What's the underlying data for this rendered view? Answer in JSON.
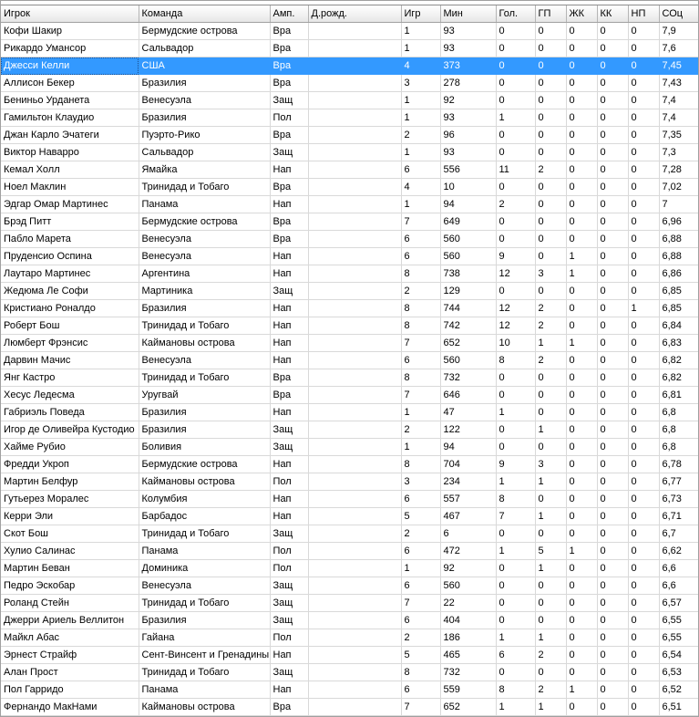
{
  "table": {
    "columns": [
      "Игрок",
      "Команда",
      "Амп.",
      "Д.рожд.",
      "Игр",
      "Мин",
      "Гол.",
      "ГП",
      "ЖК",
      "КК",
      "НП",
      "СОц"
    ],
    "selected_index": 2,
    "rows": [
      [
        "Кофи Шакир",
        "Бермудские острова",
        "Вра",
        "",
        "1",
        "93",
        "0",
        "0",
        "0",
        "0",
        "0",
        "7,9"
      ],
      [
        "Рикардо Умансор",
        "Сальвадор",
        "Вра",
        "",
        "1",
        "93",
        "0",
        "0",
        "0",
        "0",
        "0",
        "7,6"
      ],
      [
        "Джесси Келли",
        "США",
        "Вра",
        "",
        "4",
        "373",
        "0",
        "0",
        "0",
        "0",
        "0",
        "7,45"
      ],
      [
        "Аллисон Бекер",
        "Бразилия",
        "Вра",
        "",
        "3",
        "278",
        "0",
        "0",
        "0",
        "0",
        "0",
        "7,43"
      ],
      [
        "Бениньо Урданета",
        "Венесуэла",
        "Защ",
        "",
        "1",
        "92",
        "0",
        "0",
        "0",
        "0",
        "0",
        "7,4"
      ],
      [
        "Гамильтон Клаудио",
        "Бразилия",
        "Пол",
        "",
        "1",
        "93",
        "1",
        "0",
        "0",
        "0",
        "0",
        "7,4"
      ],
      [
        "Джан Карло Эчатеги",
        "Пуэрто-Рико",
        "Вра",
        "",
        "2",
        "96",
        "0",
        "0",
        "0",
        "0",
        "0",
        "7,35"
      ],
      [
        "Виктор Наварро",
        "Сальвадор",
        "Защ",
        "",
        "1",
        "93",
        "0",
        "0",
        "0",
        "0",
        "0",
        "7,3"
      ],
      [
        "Кемал Холл",
        "Ямайка",
        "Нап",
        "",
        "6",
        "556",
        "11",
        "2",
        "0",
        "0",
        "0",
        "7,28"
      ],
      [
        "Ноел Маклин",
        "Тринидад и Тобаго",
        "Вра",
        "",
        "4",
        "10",
        "0",
        "0",
        "0",
        "0",
        "0",
        "7,02"
      ],
      [
        "Эдгар Омар Мартинес",
        "Панама",
        "Нап",
        "",
        "1",
        "94",
        "2",
        "0",
        "0",
        "0",
        "0",
        "7"
      ],
      [
        "Брэд Питт",
        "Бермудские острова",
        "Вра",
        "",
        "7",
        "649",
        "0",
        "0",
        "0",
        "0",
        "0",
        "6,96"
      ],
      [
        "Пабло Марета",
        "Венесуэла",
        "Вра",
        "",
        "6",
        "560",
        "0",
        "0",
        "0",
        "0",
        "0",
        "6,88"
      ],
      [
        "Пруденсио Оспина",
        "Венесуэла",
        "Нап",
        "",
        "6",
        "560",
        "9",
        "0",
        "1",
        "0",
        "0",
        "6,88"
      ],
      [
        "Лаутаро Мартинес",
        "Аргентина",
        "Нап",
        "",
        "8",
        "738",
        "12",
        "3",
        "1",
        "0",
        "0",
        "6,86"
      ],
      [
        "Жедюма Ле Софи",
        "Мартиника",
        "Защ",
        "",
        "2",
        "129",
        "0",
        "0",
        "0",
        "0",
        "0",
        "6,85"
      ],
      [
        "Кристиано Роналдо",
        "Бразилия",
        "Нап",
        "",
        "8",
        "744",
        "12",
        "2",
        "0",
        "0",
        "1",
        "6,85"
      ],
      [
        "Роберт Бош",
        "Тринидад и Тобаго",
        "Нап",
        "",
        "8",
        "742",
        "12",
        "2",
        "0",
        "0",
        "0",
        "6,84"
      ],
      [
        "Люмберт Фрэнсис",
        "Каймановы острова",
        "Нап",
        "",
        "7",
        "652",
        "10",
        "1",
        "1",
        "0",
        "0",
        "6,83"
      ],
      [
        "Дарвин Мачис",
        "Венесуэла",
        "Нап",
        "",
        "6",
        "560",
        "8",
        "2",
        "0",
        "0",
        "0",
        "6,82"
      ],
      [
        "Янг Кастро",
        "Тринидад и Тобаго",
        "Вра",
        "",
        "8",
        "732",
        "0",
        "0",
        "0",
        "0",
        "0",
        "6,82"
      ],
      [
        "Хесус Ледесма",
        "Уругвай",
        "Вра",
        "",
        "7",
        "646",
        "0",
        "0",
        "0",
        "0",
        "0",
        "6,81"
      ],
      [
        "Габриэль Поведа",
        "Бразилия",
        "Нап",
        "",
        "1",
        "47",
        "1",
        "0",
        "0",
        "0",
        "0",
        "6,8"
      ],
      [
        "Игор де Оливейра Кустодио",
        "Бразилия",
        "Защ",
        "",
        "2",
        "122",
        "0",
        "1",
        "0",
        "0",
        "0",
        "6,8"
      ],
      [
        "Хайме Рубио",
        "Боливия",
        "Защ",
        "",
        "1",
        "94",
        "0",
        "0",
        "0",
        "0",
        "0",
        "6,8"
      ],
      [
        "Фредди Укроп",
        "Бермудские острова",
        "Нап",
        "",
        "8",
        "704",
        "9",
        "3",
        "0",
        "0",
        "0",
        "6,78"
      ],
      [
        "Мартин Белфур",
        "Каймановы острова",
        "Пол",
        "",
        "3",
        "234",
        "1",
        "1",
        "0",
        "0",
        "0",
        "6,77"
      ],
      [
        "Гутьерез Моралес",
        "Колумбия",
        "Нап",
        "",
        "6",
        "557",
        "8",
        "0",
        "0",
        "0",
        "0",
        "6,73"
      ],
      [
        "Керри Эли",
        "Барбадос",
        "Нап",
        "",
        "5",
        "467",
        "7",
        "1",
        "0",
        "0",
        "0",
        "6,71"
      ],
      [
        "Скот Бош",
        "Тринидад и Тобаго",
        "Защ",
        "",
        "2",
        "6",
        "0",
        "0",
        "0",
        "0",
        "0",
        "6,7"
      ],
      [
        "Хулио Салинас",
        "Панама",
        "Пол",
        "",
        "6",
        "472",
        "1",
        "5",
        "1",
        "0",
        "0",
        "6,62"
      ],
      [
        "Мартин Беван",
        "Доминика",
        "Пол",
        "",
        "1",
        "92",
        "0",
        "1",
        "0",
        "0",
        "0",
        "6,6"
      ],
      [
        "Педро Эскобар",
        "Венесуэла",
        "Защ",
        "",
        "6",
        "560",
        "0",
        "0",
        "0",
        "0",
        "0",
        "6,6"
      ],
      [
        "Роланд Стейн",
        "Тринидад и Тобаго",
        "Защ",
        "",
        "7",
        "22",
        "0",
        "0",
        "0",
        "0",
        "0",
        "6,57"
      ],
      [
        "Джерри Ариель Веллитон",
        "Бразилия",
        "Защ",
        "",
        "6",
        "404",
        "0",
        "0",
        "0",
        "0",
        "0",
        "6,55"
      ],
      [
        "Майкл Абас",
        "Гайана",
        "Пол",
        "",
        "2",
        "186",
        "1",
        "1",
        "0",
        "0",
        "0",
        "6,55"
      ],
      [
        "Эрнест Страйф",
        "Сент-Винсент и Гренадины",
        "Нап",
        "",
        "5",
        "465",
        "6",
        "2",
        "0",
        "0",
        "0",
        "6,54"
      ],
      [
        "Алан Прост",
        "Тринидад и Тобаго",
        "Защ",
        "",
        "8",
        "732",
        "0",
        "0",
        "0",
        "0",
        "0",
        "6,53"
      ],
      [
        "Пол Гарридо",
        "Панама",
        "Нап",
        "",
        "6",
        "559",
        "8",
        "2",
        "1",
        "0",
        "0",
        "6,52"
      ],
      [
        "Фернандо МакНами",
        "Каймановы острова",
        "Вра",
        "",
        "7",
        "652",
        "1",
        "1",
        "0",
        "0",
        "0",
        "6,51"
      ]
    ]
  }
}
